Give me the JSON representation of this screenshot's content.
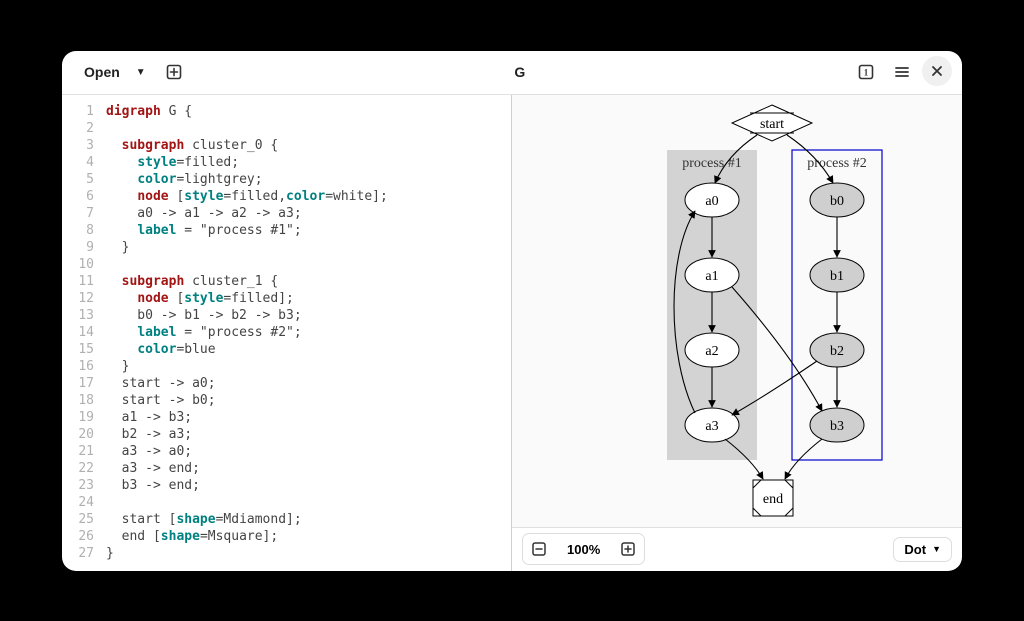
{
  "titlebar": {
    "open_label": "Open",
    "title": "G"
  },
  "editor": {
    "lines": [
      [
        [
          "kw",
          "digraph"
        ],
        [
          "txt",
          " G {"
        ]
      ],
      [],
      [
        [
          "txt",
          "  "
        ],
        [
          "kw",
          "subgraph"
        ],
        [
          "txt",
          " cluster_0 {"
        ]
      ],
      [
        [
          "txt",
          "    "
        ],
        [
          "attr",
          "style"
        ],
        [
          "txt",
          "=filled;"
        ]
      ],
      [
        [
          "txt",
          "    "
        ],
        [
          "attr",
          "color"
        ],
        [
          "txt",
          "=lightgrey;"
        ]
      ],
      [
        [
          "txt",
          "    "
        ],
        [
          "kw",
          "node"
        ],
        [
          "txt",
          " ["
        ],
        [
          "attr",
          "style"
        ],
        [
          "txt",
          "=filled,"
        ],
        [
          "attr",
          "color"
        ],
        [
          "txt",
          "=white];"
        ]
      ],
      [
        [
          "txt",
          "    a0 -> a1 -> a2 -> a3;"
        ]
      ],
      [
        [
          "txt",
          "    "
        ],
        [
          "attr",
          "label"
        ],
        [
          "txt",
          " = \"process #1\";"
        ]
      ],
      [
        [
          "txt",
          "  }"
        ]
      ],
      [],
      [
        [
          "txt",
          "  "
        ],
        [
          "kw",
          "subgraph"
        ],
        [
          "txt",
          " cluster_1 {"
        ]
      ],
      [
        [
          "txt",
          "    "
        ],
        [
          "kw",
          "node"
        ],
        [
          "txt",
          " ["
        ],
        [
          "attr",
          "style"
        ],
        [
          "txt",
          "=filled];"
        ]
      ],
      [
        [
          "txt",
          "    b0 -> b1 -> b2 -> b3;"
        ]
      ],
      [
        [
          "txt",
          "    "
        ],
        [
          "attr",
          "label"
        ],
        [
          "txt",
          " = \"process #2\";"
        ]
      ],
      [
        [
          "txt",
          "    "
        ],
        [
          "attr",
          "color"
        ],
        [
          "txt",
          "=blue"
        ]
      ],
      [
        [
          "txt",
          "  }"
        ]
      ],
      [
        [
          "txt",
          "  start -> a0;"
        ]
      ],
      [
        [
          "txt",
          "  start -> b0;"
        ]
      ],
      [
        [
          "txt",
          "  a1 -> b3;"
        ]
      ],
      [
        [
          "txt",
          "  b2 -> a3;"
        ]
      ],
      [
        [
          "txt",
          "  a3 -> a0;"
        ]
      ],
      [
        [
          "txt",
          "  a3 -> end;"
        ]
      ],
      [
        [
          "txt",
          "  b3 -> end;"
        ]
      ],
      [],
      [
        [
          "txt",
          "  start ["
        ],
        [
          "attr",
          "shape"
        ],
        [
          "txt",
          "=Mdiamond];"
        ]
      ],
      [
        [
          "txt",
          "  end ["
        ],
        [
          "attr",
          "shape"
        ],
        [
          "txt",
          "=Msquare];"
        ]
      ],
      [
        [
          "txt",
          "}"
        ]
      ]
    ]
  },
  "graph": {
    "cluster0_label": "process #1",
    "cluster1_label": "process #2",
    "start": "start",
    "end": "end",
    "a0": "a0",
    "a1": "a1",
    "a2": "a2",
    "a3": "a3",
    "b0": "b0",
    "b1": "b1",
    "b2": "b2",
    "b3": "b3"
  },
  "bottombar": {
    "zoom_label": "100%",
    "engine_label": "Dot"
  }
}
